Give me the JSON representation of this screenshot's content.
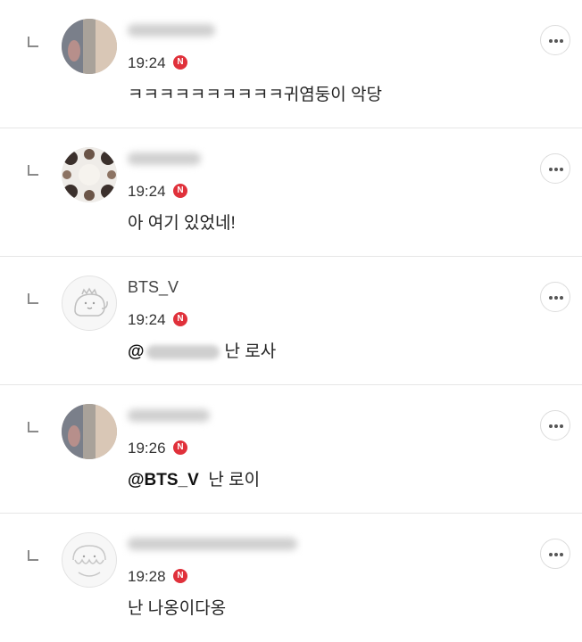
{
  "comments": [
    {
      "author": "",
      "time": "19:24",
      "badge": "N",
      "text": "ㅋㅋㅋㅋㅋㅋㅋㅋㅋㅋ귀염둥이 악당"
    },
    {
      "author": "",
      "time": "19:24",
      "badge": "N",
      "text": "아 여기 있었네!"
    },
    {
      "author": "BTS_V",
      "time": "19:24",
      "badge": "N",
      "mention": "@",
      "text": "난 로사"
    },
    {
      "author": "",
      "time": "19:26",
      "badge": "N",
      "mention": "@BTS_V",
      "text": "난 로이"
    },
    {
      "author": "",
      "time": "19:28",
      "badge": "N",
      "text": "난 나옹이다옹"
    }
  ],
  "icons": {
    "reply": "reply-arrow-icon",
    "more": "more-options-icon",
    "badge": "new-badge-icon"
  },
  "colors": {
    "badge": "#e0313b",
    "divider": "#e6e6e6",
    "text": "#222222"
  }
}
